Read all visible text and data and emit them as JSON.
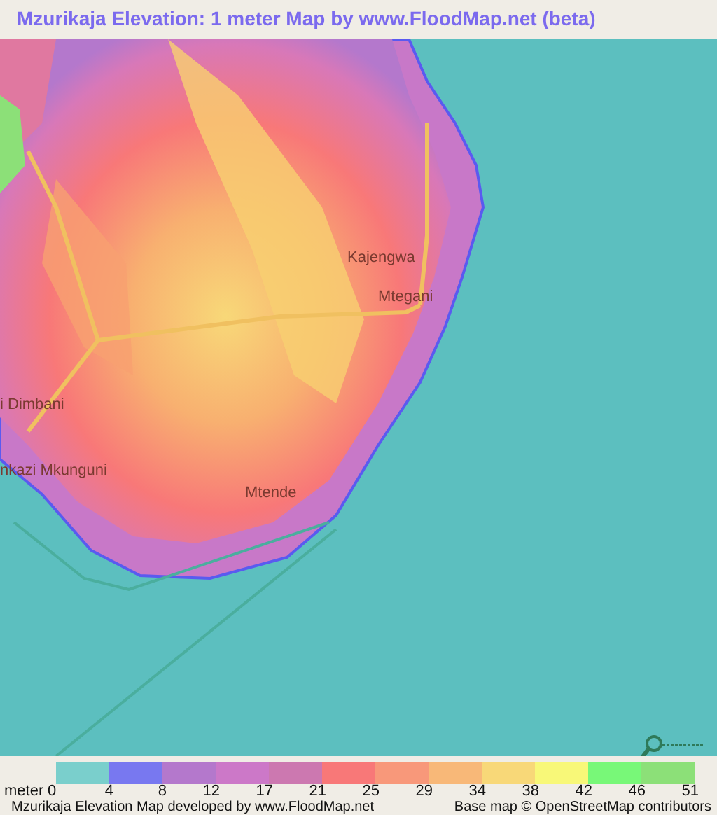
{
  "title": "Mzurikaja Elevation: 1 meter Map by www.FloodMap.net (beta)",
  "map": {
    "places": [
      {
        "name": "Kajengwa"
      },
      {
        "name": "Mtegani"
      },
      {
        "name": "i Dimbani"
      },
      {
        "name": "nkazi Mkunguni"
      },
      {
        "name": "Mtende"
      }
    ]
  },
  "legend": {
    "unit": "meter",
    "swatches": [
      {
        "color": "#7acfcc"
      },
      {
        "color": "#7878f0"
      },
      {
        "color": "#b478cc"
      },
      {
        "color": "#cc78c8"
      },
      {
        "color": "#cc78b0"
      },
      {
        "color": "#f87878"
      },
      {
        "color": "#f8987a"
      },
      {
        "color": "#f8b878"
      },
      {
        "color": "#f8d878"
      },
      {
        "color": "#f8f878"
      },
      {
        "color": "#78f878"
      },
      {
        "color": "#8ce078"
      }
    ],
    "ticks": [
      "0",
      "4",
      "8",
      "12",
      "17",
      "21",
      "25",
      "29",
      "34",
      "38",
      "42",
      "46",
      "51"
    ]
  },
  "footer": {
    "left": "Mzurikaja Elevation Map developed by www.FloodMap.net",
    "right": "Base map © OpenStreetMap contributors"
  }
}
